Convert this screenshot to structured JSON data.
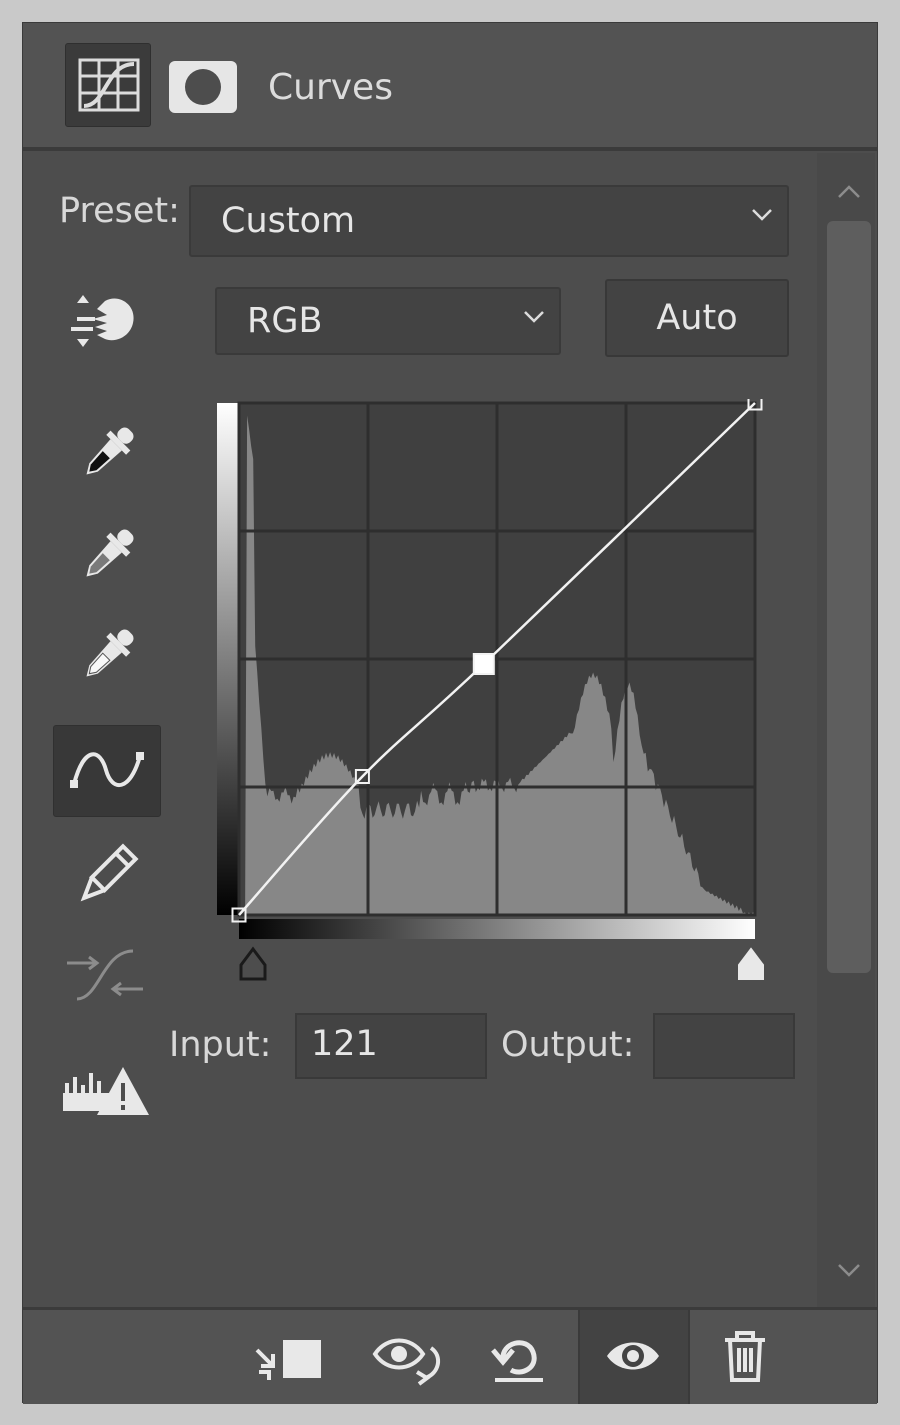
{
  "header": {
    "title": "Curves",
    "adjustment_icon": "curves-adjustment-icon",
    "mask_icon": "layer-mask-icon"
  },
  "preset": {
    "label": "Preset:",
    "value": "Custom"
  },
  "channel": {
    "value": "RGB"
  },
  "auto_label": "Auto",
  "tools": [
    "on-image-adjust-icon",
    "black-point-eyedropper-icon",
    "gray-point-eyedropper-icon",
    "white-point-eyedropper-icon",
    "curve-point-tool-icon",
    "pencil-draw-icon",
    "smooth-curve-icon",
    "clipping-warning-icon"
  ],
  "curve_points": [
    [
      0,
      0
    ],
    [
      61,
      69
    ],
    [
      121,
      125
    ],
    [
      255,
      255
    ]
  ],
  "selected_point_input": 121,
  "input": {
    "label": "Input:",
    "value": "121"
  },
  "output": {
    "label": "Output:",
    "value": ""
  },
  "footer": {
    "icons": [
      "clip-to-layer-icon",
      "view-previous-state-icon",
      "reset-icon",
      "visibility-eye-icon",
      "trash-icon"
    ]
  },
  "colors": {
    "panel": "#4d4d4d",
    "graph_bg": "#404040",
    "histogram": "#878787",
    "curve": "#f2f2f2"
  }
}
